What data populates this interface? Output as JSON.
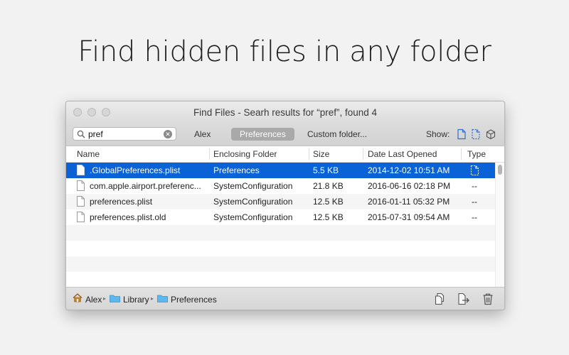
{
  "headline": "Find hidden files in any folder",
  "window": {
    "title": "Find Files - Searh results for “pref”, found 4"
  },
  "toolbar": {
    "search_value": "pref",
    "scopes": [
      "Alex",
      "Preferences",
      "Custom folder..."
    ],
    "active_scope": "Preferences",
    "show_label": "Show:"
  },
  "columns": [
    "Name",
    "Enclosing Folder",
    "Size",
    "Date Last Opened",
    "Type"
  ],
  "rows": [
    {
      "name": ".GlobalPreferences.plist",
      "folder": "Preferences",
      "size": "5.5 KB",
      "date": "2014-12-02 10:51 AM",
      "type": "hidden-file-icon",
      "selected": true
    },
    {
      "name": "com.apple.airport.preferenc...",
      "folder": "SystemConfiguration",
      "size": "21.8 KB",
      "date": "2016-06-16 02:18 PM",
      "type": "--"
    },
    {
      "name": "preferences.plist",
      "folder": "SystemConfiguration",
      "size": "12.5 KB",
      "date": "2016-01-11 05:32 PM",
      "type": "--"
    },
    {
      "name": "preferences.plist.old",
      "folder": "SystemConfiguration",
      "size": "12.5 KB",
      "date": "2015-07-31 09:54 AM",
      "type": "--"
    }
  ],
  "breadcrumb": [
    "Alex",
    "Library",
    "Preferences"
  ],
  "colors": {
    "selection": "#0a63d6",
    "folder_icon": "#5db8f0",
    "home_icon": "#c8802e"
  }
}
